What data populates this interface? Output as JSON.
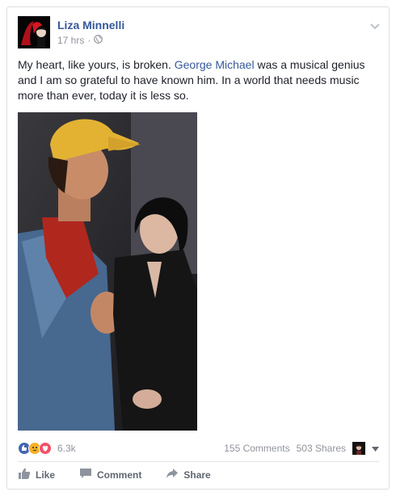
{
  "post": {
    "author": "Liza Minnelli",
    "time": "17 hrs",
    "meta_separator": "·",
    "text_before": "My heart, like yours, is broken. ",
    "text_link": "George Michael",
    "text_after": " was a musical genius and I am so grateful to have known him. In a world that needs music more than ever, today it is less so.",
    "reactions_count": "6.3k",
    "comments": "155 Comments",
    "shares": "503 Shares"
  },
  "actions": {
    "like": "Like",
    "comment": "Comment",
    "share": "Share"
  },
  "icons": [
    "globe-icon",
    "chevron-down-icon",
    "like-icon",
    "comment-icon",
    "share-icon"
  ],
  "colors": {
    "link": "#365899",
    "muted": "#90949c",
    "like_reaction": "#4267b2",
    "sad_reaction": "#f7b125",
    "love_reaction": "#f25268"
  }
}
